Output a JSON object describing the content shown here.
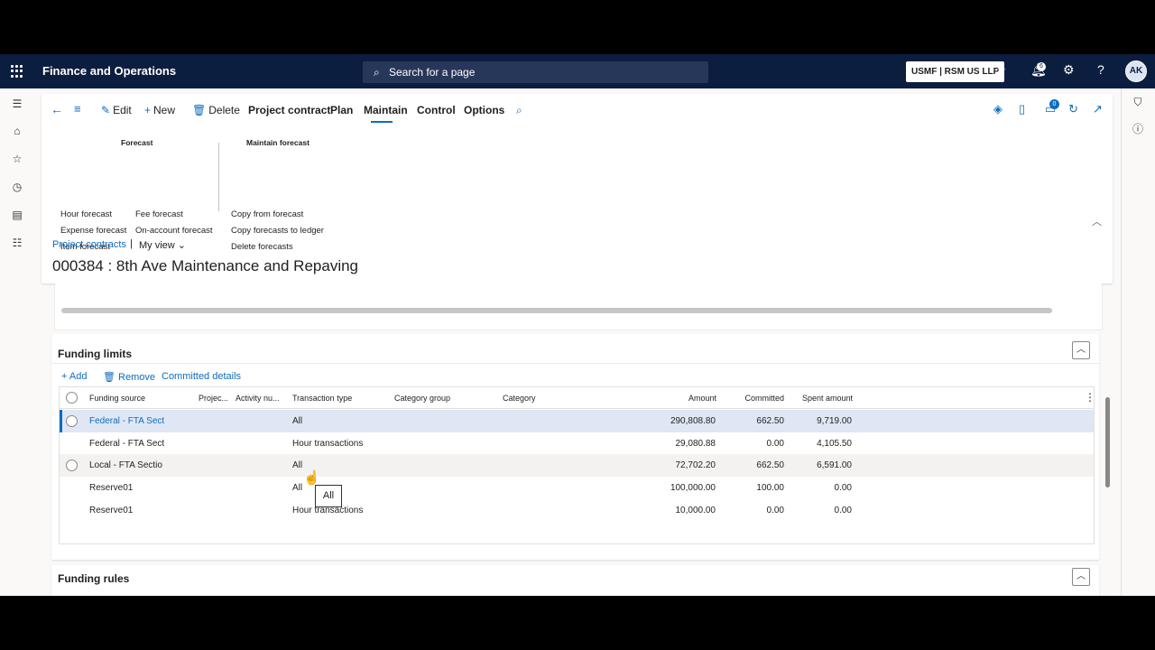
{
  "topbar": {
    "app_title": "Finance and Operations",
    "search_placeholder": "Search for a page",
    "company": "USMF | RSM US LLP",
    "notification_count": "6",
    "avatar_initials": "AK"
  },
  "actionpane": {
    "edit": "Edit",
    "new": "New",
    "delete": "Delete",
    "tabs": [
      "Project contract",
      "Plan",
      "Maintain",
      "Control",
      "Options"
    ],
    "active_tab": "Plan",
    "attachments_count": "0",
    "groups": {
      "forecast": {
        "title": "Forecast",
        "links": [
          "Hour forecast",
          "Expense forecast",
          "Item forecast",
          "Fee forecast",
          "On-account forecast"
        ]
      },
      "maintain_forecast": {
        "title": "Maintain forecast",
        "links": [
          "Copy from forecast",
          "Copy forecasts to ledger",
          "Delete forecasts"
        ]
      }
    }
  },
  "header": {
    "breadcrumb": "Project contracts",
    "separator": "|",
    "view": "My view",
    "title": "000384 : 8th Ave Maintenance and Repaving"
  },
  "funding_limits": {
    "title": "Funding limits",
    "actions": {
      "add": "Add",
      "remove": "Remove",
      "committed_details": "Committed details"
    },
    "columns": [
      "Funding source",
      "Projec...",
      "Activity nu...",
      "Transaction type",
      "Category group",
      "Category",
      "Amount",
      "Committed",
      "Spent amount"
    ],
    "rows": [
      {
        "funding_source": "Federal - FTA Sect",
        "transaction_type": "All",
        "amount": "290,808.80",
        "committed": "662.50",
        "spent": "9,719.00"
      },
      {
        "funding_source": "Federal - FTA Sect",
        "transaction_type": "Hour transactions",
        "amount": "29,080.88",
        "committed": "0.00",
        "spent": "4,105.50"
      },
      {
        "funding_source": "Local - FTA Sectio",
        "transaction_type": "All",
        "amount": "72,702.20",
        "committed": "662.50",
        "spent": "6,591.00"
      },
      {
        "funding_source": "Reserve01",
        "transaction_type": "All",
        "amount": "100,000.00",
        "committed": "100.00",
        "spent": "0.00"
      },
      {
        "funding_source": "Reserve01",
        "transaction_type": "Hour transactions",
        "amount": "10,000.00",
        "committed": "0.00",
        "spent": "0.00"
      }
    ],
    "tooltip": "All"
  },
  "funding_rules": {
    "title": "Funding rules"
  },
  "colors": {
    "topbar": "#0c1e3f",
    "accent": "#0f6cbd",
    "selected_row": "#dfe7f4"
  }
}
